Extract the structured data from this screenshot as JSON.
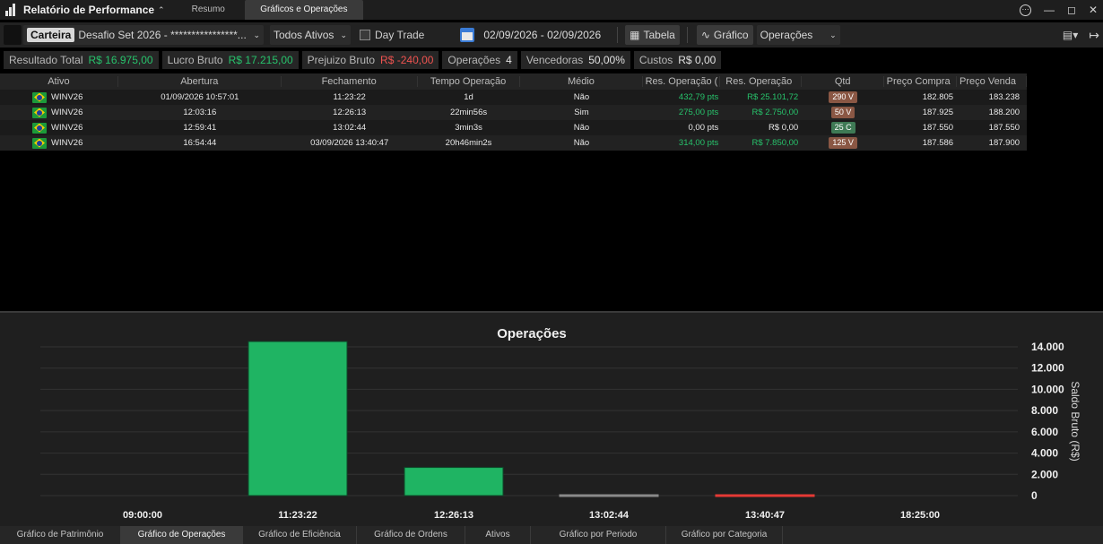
{
  "window": {
    "title": "Relatório de Performance",
    "tabs": [
      {
        "label": "Resumo",
        "active": false
      },
      {
        "label": "Gráficos e Operações",
        "active": true
      }
    ]
  },
  "toolbar": {
    "carteira_label": "Carteira",
    "carteira_value": "Desafio Set 2026 - ****************...",
    "ativos_value": "Todos Ativos",
    "daytrade_label": "Day Trade",
    "date_range": "02/09/2026 - 02/09/2026",
    "tabela_label": "Tabela",
    "grafico_label": "Gráfico",
    "operacoes_value": "Operações"
  },
  "summary": [
    {
      "label": "Resultado Total",
      "value": "R$ 16.975,00",
      "tone": "pos"
    },
    {
      "label": "Lucro Bruto",
      "value": "R$ 17.215,00",
      "tone": "pos"
    },
    {
      "label": "Prejuizo Bruto",
      "value": "R$ -240,00",
      "tone": "neg"
    },
    {
      "label": "Operações",
      "value": "4",
      "tone": "neutral"
    },
    {
      "label": "Vencedoras",
      "value": "50,00%",
      "tone": "neutral"
    },
    {
      "label": "Custos",
      "value": "R$ 0,00",
      "tone": "neutral"
    }
  ],
  "table": {
    "headers": [
      "Ativo",
      "Abertura",
      "Fechamento",
      "Tempo Operação",
      "Médio",
      "Res. Operação (",
      "Res. Operação",
      "Qtd",
      "Preço Compra",
      "Preço Venda"
    ],
    "rows": [
      {
        "ativo": "WINV26",
        "abertura": "01/09/2026 10:57:01",
        "fechamento": "11:23:22",
        "tempo": "1d",
        "medio": "Não",
        "res_pts": "432,79 pts",
        "res_rs": "R$ 25.101,72",
        "qtd": "290 V",
        "qtd_side": "v",
        "preco_compra": "182.805",
        "preco_venda": "183.238"
      },
      {
        "ativo": "WINV26",
        "abertura": "12:03:16",
        "fechamento": "12:26:13",
        "tempo": "22min56s",
        "medio": "Sim",
        "res_pts": "275,00 pts",
        "res_rs": "R$ 2.750,00",
        "qtd": "50 V",
        "qtd_side": "v",
        "preco_compra": "187.925",
        "preco_venda": "188.200"
      },
      {
        "ativo": "WINV26",
        "abertura": "12:59:41",
        "fechamento": "13:02:44",
        "tempo": "3min3s",
        "medio": "Não",
        "res_pts": "0,00 pts",
        "res_rs": "R$ 0,00",
        "qtd": "25 C",
        "qtd_side": "c",
        "preco_compra": "187.550",
        "preco_venda": "187.550"
      },
      {
        "ativo": "WINV26",
        "abertura": "16:54:44",
        "fechamento": "03/09/2026 13:40:47",
        "tempo": "20h46min2s",
        "medio": "Não",
        "res_pts": "314,00 pts",
        "res_rs": "R$ 7.850,00",
        "qtd": "125 V",
        "qtd_side": "v",
        "preco_compra": "187.586",
        "preco_venda": "187.900"
      }
    ]
  },
  "chart_data": {
    "type": "bar",
    "title": "Operações",
    "ylabel": "Saldo Bruto (R$)",
    "x_ticks": [
      "09:00:00",
      "11:23:22",
      "12:26:13",
      "13:02:44",
      "13:40:47",
      "18:25:00"
    ],
    "categories": [
      "11:23:22",
      "12:26:13",
      "13:02:44",
      "13:40:47"
    ],
    "values": [
      14500,
      2650,
      0,
      -240
    ],
    "y_ticks": [
      "14.000",
      "12.000",
      "10.000",
      "8.000",
      "6.000",
      "4.000",
      "2.000",
      "0"
    ],
    "y_tick_values": [
      14000,
      12000,
      10000,
      8000,
      6000,
      4000,
      2000,
      0
    ],
    "ylim": [
      -500,
      15000
    ],
    "grid": true,
    "colors": {
      "positive": "#1fb463",
      "zero": "#8a8a8a",
      "negative": "#e53935"
    }
  },
  "bottom_tabs": [
    {
      "label": "Gráfico de Patrimônio",
      "active": false
    },
    {
      "label": "Gráfico de Operações",
      "active": true
    },
    {
      "label": "Gráfico de Eficiência",
      "active": false
    },
    {
      "label": "Gráfico de Ordens",
      "active": false
    },
    {
      "label": "Ativos",
      "active": false
    },
    {
      "label": "Gráfico por Periodo",
      "active": false
    },
    {
      "label": "Gráfico por Categoria",
      "active": false
    }
  ]
}
